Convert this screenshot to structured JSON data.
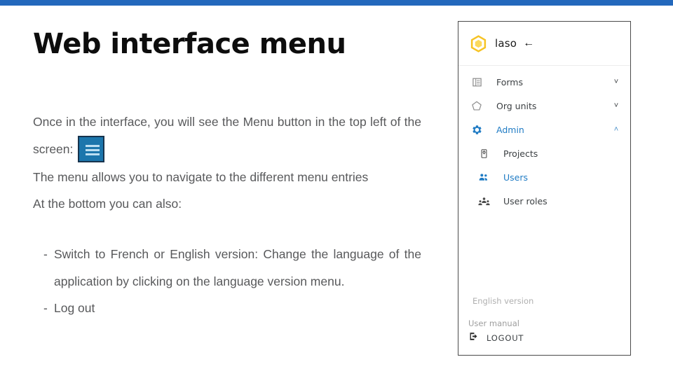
{
  "theme": {
    "top_bar_color": "#2368bc",
    "accent_blue": "#1f7bc4",
    "logo_gold": "#f6c324",
    "menu_button_fill": "#1c76ac",
    "menu_button_border": "#17334d",
    "body_text_color": "#58595b"
  },
  "slide": {
    "title": "Web interface menu",
    "paragraph_1_before_button": "Once in the interface, you will see the Menu button in the top left of the screen:",
    "menu_button_icon": "hamburger-menu-icon",
    "paragraph_2": "The menu allows you to navigate to the different menu entries",
    "paragraph_3": "At the bottom you can also:",
    "bullets": [
      {
        "marker": "-",
        "text": "Switch to French or English version: Change the language of the application by clicking on the language version menu."
      },
      {
        "marker": "-",
        "text": "Log out"
      }
    ]
  },
  "app_panel": {
    "header": {
      "logo_icon": "hexagon-logo-icon",
      "brand": "laso",
      "back_icon": "←"
    },
    "menu": [
      {
        "label": "Forms",
        "icon": "table-grid-icon",
        "chevron": "˅",
        "expanded": false,
        "active": false
      },
      {
        "label": "Org units",
        "icon": "pentagon-icon",
        "chevron": "˅",
        "expanded": false,
        "active": false
      },
      {
        "label": "Admin",
        "icon": "gear-icon",
        "chevron": "˄",
        "expanded": true,
        "active": true
      }
    ],
    "sub_menu": [
      {
        "label": "Projects",
        "icon": "device-settings-icon",
        "active": false
      },
      {
        "label": "Users",
        "icon": "people-icon",
        "active": true
      },
      {
        "label": "User roles",
        "icon": "people-group-icon",
        "active": false
      }
    ],
    "footer": {
      "language_version": "English version",
      "user_manual": "User manual",
      "logout_label": "LOGOUT",
      "logout_icon": "logout-icon"
    }
  }
}
